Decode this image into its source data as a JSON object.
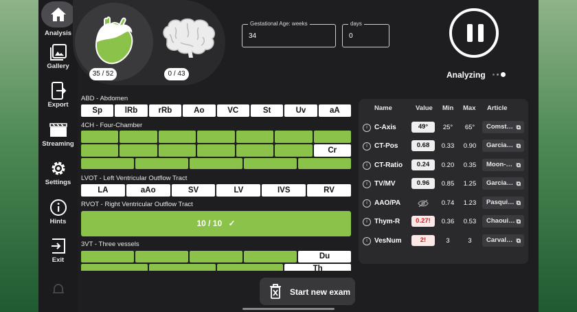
{
  "nav": [
    {
      "label": "Analysis",
      "icon": "home-icon",
      "active": true
    },
    {
      "label": "Gallery",
      "icon": "gallery-icon"
    },
    {
      "label": "Export",
      "icon": "export-icon"
    },
    {
      "label": "Streaming",
      "icon": "streaming-icon"
    },
    {
      "label": "Settings",
      "icon": "gear-icon"
    },
    {
      "label": "Hints",
      "icon": "info-icon"
    },
    {
      "label": "Exit",
      "icon": "exit-icon"
    }
  ],
  "organs": {
    "heart_count": "35 / 52",
    "brain_count": "0 / 43"
  },
  "gestational": {
    "weeks_label": "Gestational Age: weeks",
    "weeks_value": "34",
    "days_label": "days",
    "days_value": "0"
  },
  "status": {
    "label": "Analyzing"
  },
  "sections": {
    "abd": {
      "title": "ABD - Abdomen",
      "tags": [
        "Sp",
        "lRb",
        "rRb",
        "Ao",
        "VC",
        "St",
        "Uv",
        "aA"
      ]
    },
    "fourch": {
      "title": "4CH - Four-Chamber",
      "cell": "Cr"
    },
    "lvot": {
      "title": "LVOT - Left Ventricular Outflow Tract",
      "tags": [
        "LA",
        "aAo",
        "SV",
        "LV",
        "IVS",
        "RV"
      ]
    },
    "rvot": {
      "title": "RVOT - Right Ventricular Outflow Tract",
      "progress": "10 / 10",
      "check": "✓"
    },
    "tvt": {
      "title": "3VT - Three vessels",
      "cell1": "Du",
      "cell2": "Th"
    }
  },
  "table": {
    "headers": [
      "Name",
      "Value",
      "Min",
      "Max",
      "Article"
    ],
    "rows": [
      {
        "name": "C-Axis",
        "value": "49°",
        "min": "25°",
        "max": "65°",
        "article": "Comst…",
        "flag": false
      },
      {
        "name": "CT-Pos",
        "value": "0.68",
        "min": "0.33",
        "max": "0.90",
        "article": "Garcia…",
        "flag": false
      },
      {
        "name": "CT-Ratio",
        "value": "0.24",
        "min": "0.20",
        "max": "0.35",
        "article": "Moon-…",
        "flag": false
      },
      {
        "name": "TV/MV",
        "value": "0.96",
        "min": "0.85",
        "max": "1.25",
        "article": "Garcia…",
        "flag": false
      },
      {
        "name": "AAO/PA",
        "value": "",
        "min": "0.74",
        "max": "1.23",
        "article": "Pasqui…",
        "flag": false,
        "hidden": true
      },
      {
        "name": "Thym-R",
        "value": "0.27!",
        "min": "0.36",
        "max": "0.53",
        "article": "Chaoui…",
        "flag": true
      },
      {
        "name": "VesNum",
        "value": "2!",
        "min": "3",
        "max": "3",
        "article": "Carval…",
        "flag": true
      }
    ]
  },
  "action": {
    "label": "Start new exam"
  },
  "colors": {
    "green": "#8bc34a",
    "accent": "#b9a7ff",
    "background": "#1e1e20"
  }
}
